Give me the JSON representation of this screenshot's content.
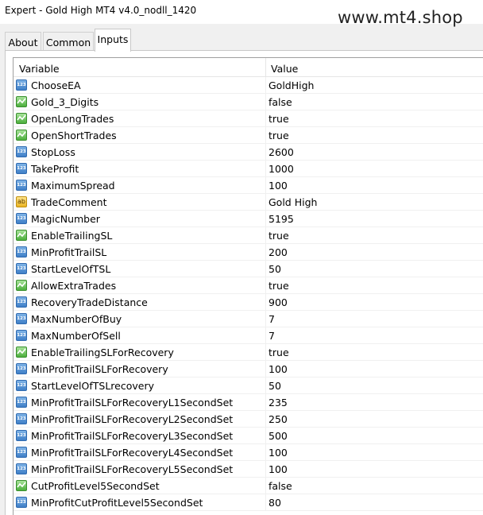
{
  "window": {
    "title": "Expert - Gold High MT4 v4.0_nodll_1420"
  },
  "watermark": "www.mt4.shop",
  "tabs": [
    {
      "label": "About"
    },
    {
      "label": "Common"
    },
    {
      "label": "Inputs",
      "active": true
    }
  ],
  "grid": {
    "columns": {
      "variable": "Variable",
      "value": "Value"
    },
    "rows": [
      {
        "name": "ChooseEA",
        "value": "GoldHigh",
        "icon": "number-icon"
      },
      {
        "name": "Gold_3_Digits",
        "value": "false",
        "icon": "bool-icon"
      },
      {
        "name": "OpenLongTrades",
        "value": "true",
        "icon": "bool-icon"
      },
      {
        "name": "OpenShortTrades",
        "value": "true",
        "icon": "bool-icon"
      },
      {
        "name": "StopLoss",
        "value": "2600",
        "icon": "number-icon"
      },
      {
        "name": "TakeProfit",
        "value": "1000",
        "icon": "number-icon"
      },
      {
        "name": "MaximumSpread",
        "value": "100",
        "icon": "number-icon"
      },
      {
        "name": "TradeComment",
        "value": "Gold High",
        "icon": "string-icon"
      },
      {
        "name": "MagicNumber",
        "value": "5195",
        "icon": "number-icon"
      },
      {
        "name": "EnableTrailingSL",
        "value": "true",
        "icon": "bool-icon"
      },
      {
        "name": "MinProfitTrailSL",
        "value": "200",
        "icon": "number-icon"
      },
      {
        "name": "StartLevelOfTSL",
        "value": "50",
        "icon": "number-icon"
      },
      {
        "name": "AllowExtraTrades",
        "value": "true",
        "icon": "bool-icon"
      },
      {
        "name": "RecoveryTradeDistance",
        "value": "900",
        "icon": "number-icon"
      },
      {
        "name": "MaxNumberOfBuy",
        "value": "7",
        "icon": "number-icon"
      },
      {
        "name": "MaxNumberOfSell",
        "value": "7",
        "icon": "number-icon"
      },
      {
        "name": "EnableTrailingSLForRecovery",
        "value": "true",
        "icon": "bool-icon"
      },
      {
        "name": "MinProfitTrailSLForRecovery",
        "value": "100",
        "icon": "number-icon"
      },
      {
        "name": "StartLevelOfTSLrecovery",
        "value": "50",
        "icon": "number-icon"
      },
      {
        "name": "MinProfitTrailSLForRecoveryL1SecondSet",
        "value": "235",
        "icon": "number-icon"
      },
      {
        "name": "MinProfitTrailSLForRecoveryL2SecondSet",
        "value": "250",
        "icon": "number-icon"
      },
      {
        "name": "MinProfitTrailSLForRecoveryL3SecondSet",
        "value": "500",
        "icon": "number-icon"
      },
      {
        "name": "MinProfitTrailSLForRecoveryL4SecondSet",
        "value": "100",
        "icon": "number-icon"
      },
      {
        "name": "MinProfitTrailSLForRecoveryL5SecondSet",
        "value": "100",
        "icon": "number-icon"
      },
      {
        "name": "CutProfitLevel5SecondSet",
        "value": "false",
        "icon": "bool-icon"
      },
      {
        "name": "MinProfitCutProfitLevel5SecondSet",
        "value": "80",
        "icon": "number-icon"
      }
    ]
  }
}
